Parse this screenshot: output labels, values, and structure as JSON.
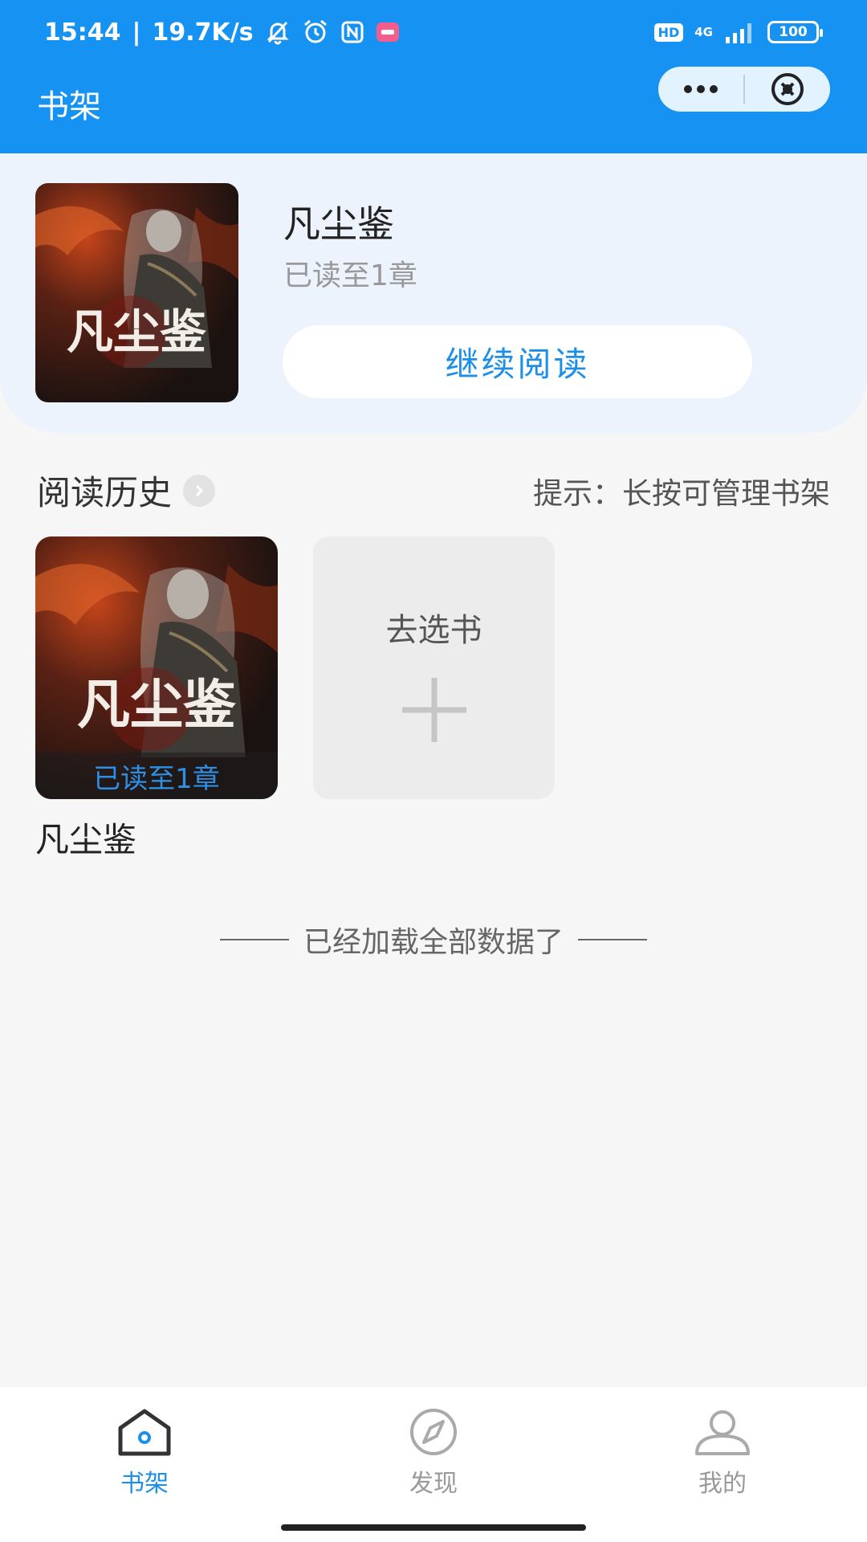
{
  "status_bar": {
    "time": "15:44",
    "separator": "|",
    "net_speed": "19.7K/s",
    "hd": "HD",
    "network": "4G",
    "battery": "100"
  },
  "header": {
    "title": "书架",
    "accent_color": "#1692f2"
  },
  "featured": {
    "title": "凡尘鉴",
    "progress": "已读至1章",
    "continue_label": "继续阅读",
    "cover_text": "凡尘鉴"
  },
  "history": {
    "title": "阅读历史",
    "hint": "提示：长按可管理书架",
    "books": [
      {
        "title": "凡尘鉴",
        "progress": "已读至1章",
        "cover_text": "凡尘鉴"
      }
    ],
    "add_label": "去选书"
  },
  "end_text": "已经加载全部数据了",
  "tabbar": {
    "items": [
      {
        "label": "书架",
        "icon": "home-icon",
        "active": true
      },
      {
        "label": "发现",
        "icon": "compass-icon",
        "active": false
      },
      {
        "label": "我的",
        "icon": "user-icon",
        "active": false
      }
    ]
  }
}
